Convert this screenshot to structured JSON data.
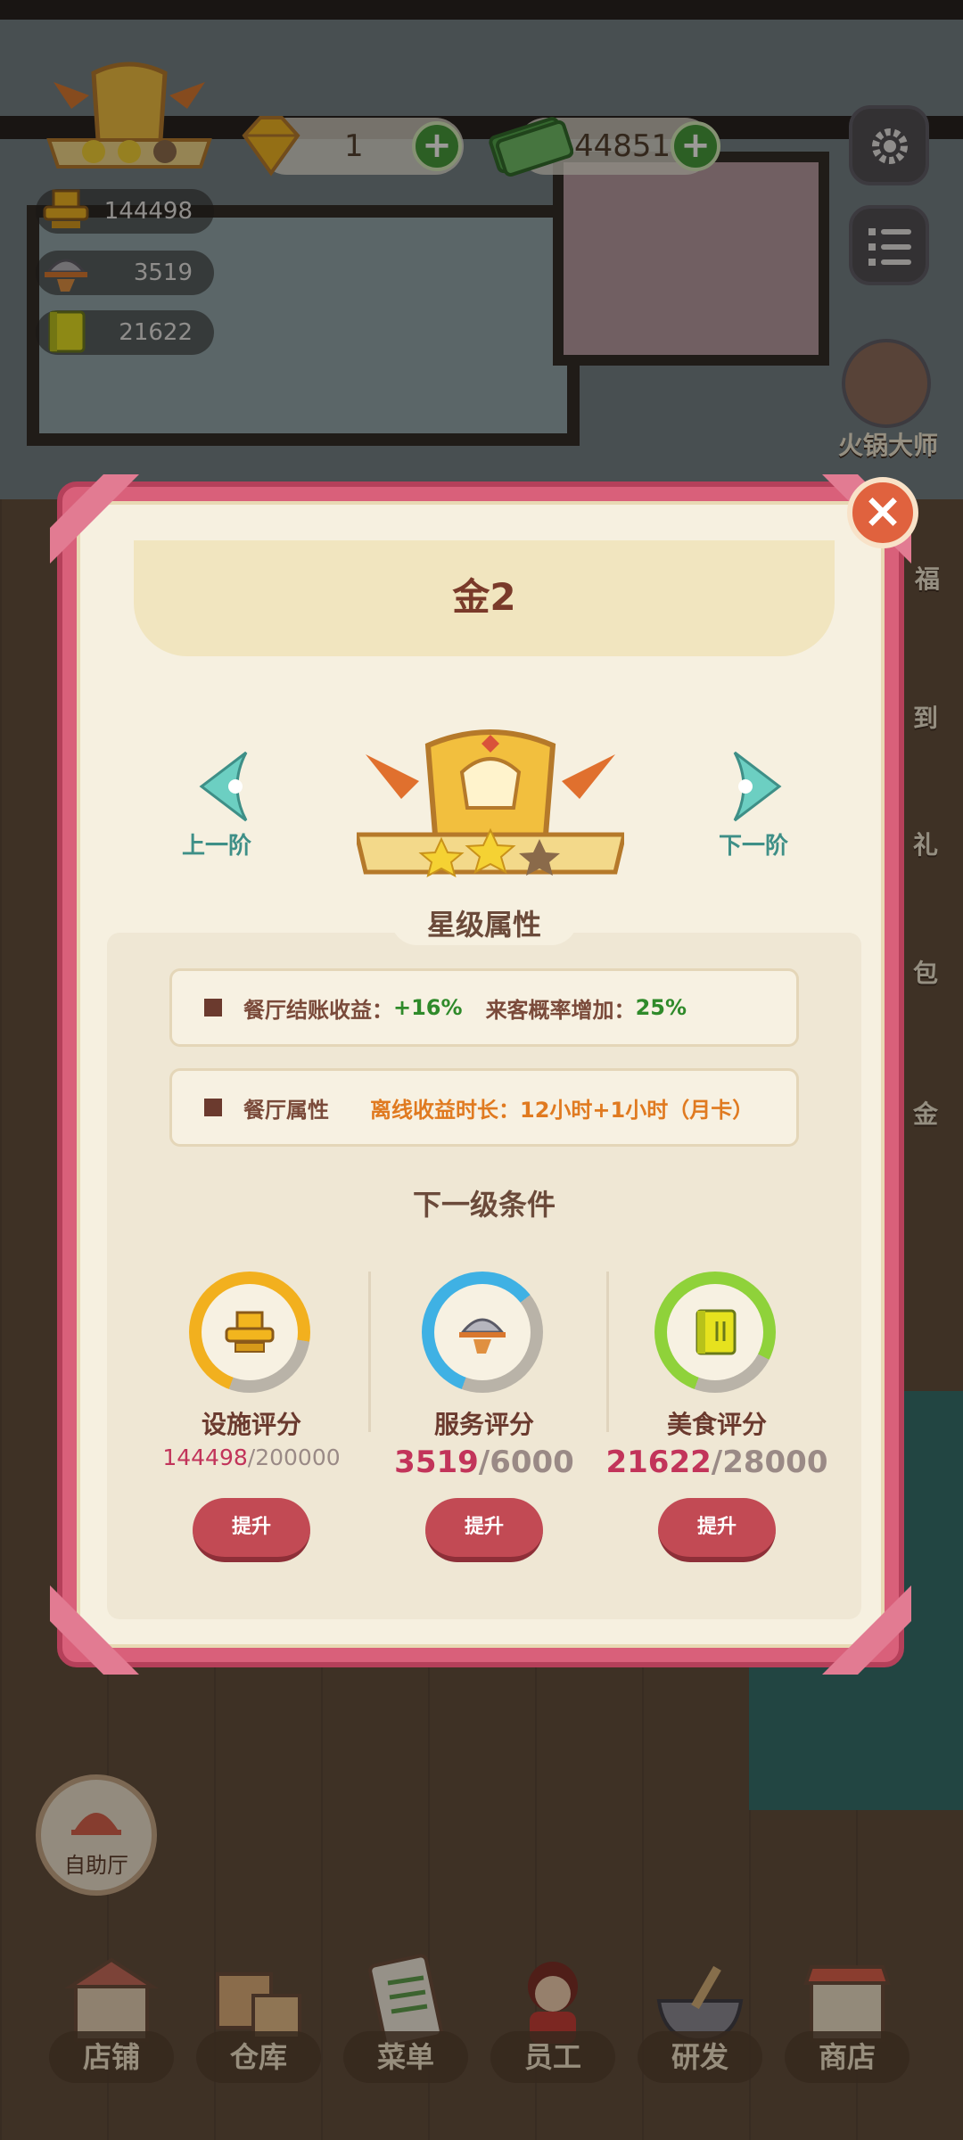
{
  "hud": {
    "gems": "1",
    "cash": "44851",
    "plus": "+",
    "facility_score": "144498",
    "service_score": "3519",
    "food_score": "21622"
  },
  "side_menu": {
    "hotpot_master": "火锅大师",
    "fu": "福",
    "sign": "到",
    "gift": "礼",
    "pack": "包",
    "gold": "金"
  },
  "buffet": "自助厅",
  "bottom_nav": [
    {
      "label": "店铺",
      "icon": "shop-icon"
    },
    {
      "label": "仓库",
      "icon": "warehouse-icon"
    },
    {
      "label": "菜单",
      "icon": "menu-icon"
    },
    {
      "label": "员工",
      "icon": "staff-icon"
    },
    {
      "label": "研发",
      "icon": "research-icon"
    },
    {
      "label": "商店",
      "icon": "store-icon"
    }
  ],
  "modal": {
    "title": "金2",
    "prev_label": "上一阶",
    "next_label": "下一阶",
    "stars": 2,
    "stars_total": 3,
    "attributes_title": "星级属性",
    "attr1_label": "餐厅结账收益：",
    "attr1_value": "+16%",
    "attr1_label2": "来客概率增加：",
    "attr1_value2": "25%",
    "attr2_label": "餐厅属性",
    "attr2_key": "离线收益时长：",
    "attr2_value": "12小时+1小时（月卡）",
    "conditions_title": "下一级条件",
    "requirements": [
      {
        "label": "设施评分",
        "current": "144498",
        "max": "/200000",
        "progress": 0.72,
        "ring_color": "#f2b01e",
        "button": "提升"
      },
      {
        "label": "服务评分",
        "current": "3519",
        "max": "/6000",
        "progress": 0.59,
        "ring_color": "#3fb1e4",
        "button": "提升"
      },
      {
        "label": "美食评分",
        "current": "21622",
        "max": "/28000",
        "progress": 0.77,
        "ring_color": "#8fd23a",
        "button": "提升"
      }
    ],
    "close": "×"
  }
}
